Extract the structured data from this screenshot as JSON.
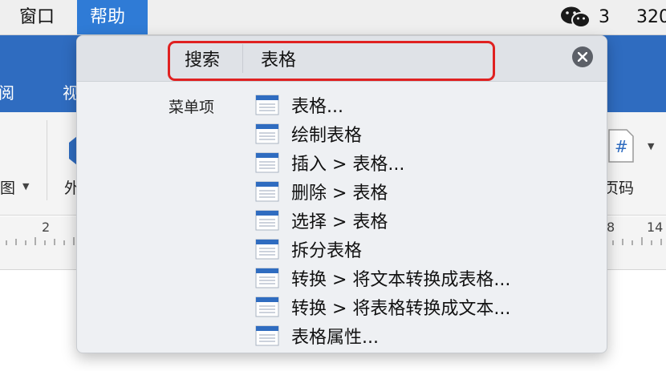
{
  "menubar": {
    "window_label": "窗口",
    "help_label": "帮助",
    "wechat_count": "3",
    "clock_partial": "320"
  },
  "ribbon": {
    "tab_review": "审阅",
    "tab_view": "视",
    "label_tu": "图",
    "label_wai": "外",
    "label_yema": "页码"
  },
  "ruler": {
    "n2": "2",
    "n8": "8",
    "n14": "14"
  },
  "help": {
    "search_label": "搜索",
    "search_value": "表格",
    "section_label": "菜单项",
    "results": [
      {
        "label": "表格..."
      },
      {
        "label": "绘制表格"
      },
      {
        "label": "插入 > 表格..."
      },
      {
        "label": "删除 > 表格"
      },
      {
        "label": "选择 > 表格"
      },
      {
        "label": "拆分表格"
      },
      {
        "label": "转换 > 将文本转换成表格..."
      },
      {
        "label": "转换 > 将表格转换成文本..."
      },
      {
        "label": "表格属性..."
      }
    ]
  },
  "colors": {
    "menu_highlight": "#2f7bd6",
    "ribbon_blue": "#2f6cc0",
    "annotation_red": "#e02121",
    "wechat_green": "#1a1a1a"
  },
  "icons": {
    "result": "menu-item-icon",
    "clear": "clear-circle-icon",
    "wechat": "wechat-icon"
  }
}
